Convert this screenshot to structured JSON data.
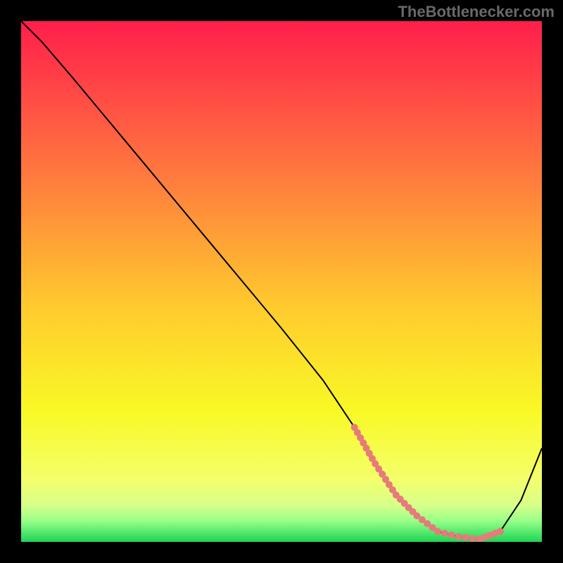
{
  "watermark": "TheBottlenecker.com",
  "chart_data": {
    "type": "line",
    "title": "",
    "xlabel": "",
    "ylabel": "",
    "xlim": [
      0,
      100
    ],
    "ylim": [
      0,
      100
    ],
    "x": [
      0,
      4,
      10,
      20,
      30,
      40,
      50,
      58,
      64,
      68,
      72,
      76,
      80,
      84,
      88,
      92,
      96,
      100
    ],
    "values": [
      100,
      96,
      89,
      77,
      65,
      53,
      41,
      31,
      22,
      15,
      9,
      5,
      2,
      1,
      0.5,
      2,
      8,
      18
    ],
    "highlight_region": {
      "x": [
        64,
        68,
        72,
        76,
        80,
        84,
        88,
        92
      ],
      "values": [
        22,
        15,
        9,
        5,
        2,
        1,
        0.5,
        2
      ],
      "style": "pink-dotted"
    },
    "background": {
      "type": "vertical-gradient",
      "stops": [
        {
          "offset": 0,
          "color": "#FF1E4B"
        },
        {
          "offset": 30,
          "color": "#FF7B3E"
        },
        {
          "offset": 55,
          "color": "#FFCB2E"
        },
        {
          "offset": 75,
          "color": "#F9F926"
        },
        {
          "offset": 88,
          "color": "#F4FF6B"
        },
        {
          "offset": 93,
          "color": "#D7FF8A"
        },
        {
          "offset": 96,
          "color": "#97FF88"
        },
        {
          "offset": 100,
          "color": "#1CD455"
        }
      ]
    }
  }
}
